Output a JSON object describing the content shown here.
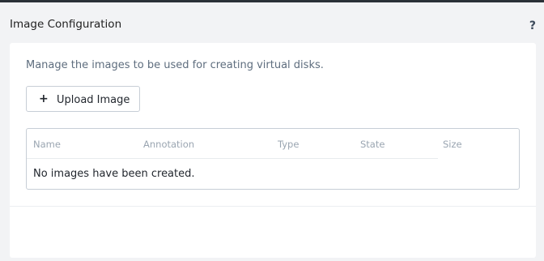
{
  "header": {
    "title": "Image Configuration",
    "help_label": "?"
  },
  "main": {
    "description": "Manage the images to be used for creating virtual disks.",
    "upload_button": {
      "icon": "plus-icon",
      "glyph": "+",
      "label": "Upload Image"
    },
    "table": {
      "columns": [
        "Name",
        "Annotation",
        "Type",
        "State",
        "Size"
      ],
      "empty_message": "No images have been created."
    }
  },
  "colors": {
    "topbar": "#2b3138",
    "background": "#f2f3f5",
    "panel": "#ffffff",
    "muted_text": "#5e6d7e",
    "header_text": "#9aa5b1",
    "border": "#c7ced6"
  }
}
